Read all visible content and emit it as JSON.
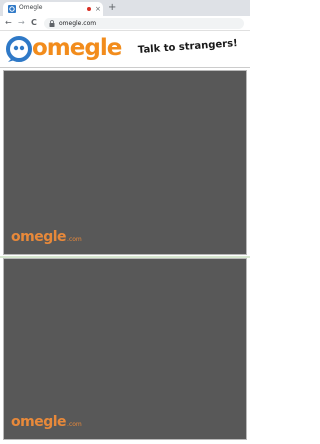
{
  "browser": {
    "tab": {
      "title": "Omegle",
      "close_glyph": "×",
      "recording_indicator": "recording-dot"
    },
    "new_tab_glyph": "+",
    "nav": {
      "back_glyph": "←",
      "forward_glyph": "→",
      "reload_glyph": "C"
    },
    "url": "omegle.com"
  },
  "site": {
    "logo_text": "omegle",
    "tagline": "Talk to strangers!",
    "brand_color": "#f28c1c",
    "accent_blue": "#2f79c7"
  },
  "videos": [
    {
      "watermark_name": "omegle",
      "watermark_suffix": ".com"
    },
    {
      "watermark_name": "omegle",
      "watermark_suffix": ".com"
    }
  ]
}
